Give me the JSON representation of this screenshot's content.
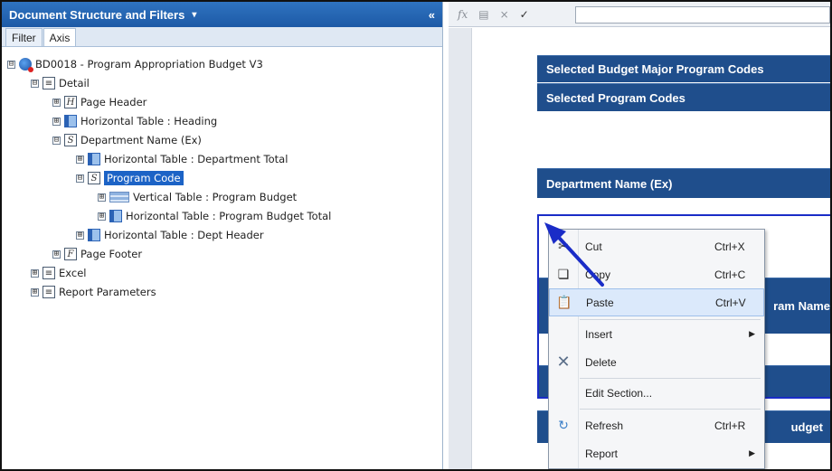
{
  "panel": {
    "title": "Document Structure and Filters",
    "dropdown_glyph": "▾",
    "collapse_glyph": "«",
    "tabs": [
      "Filter",
      "Axis"
    ]
  },
  "tree": {
    "items": [
      {
        "label": "BD0018 - Program Appropriation Budget V3",
        "icon": "report-icon",
        "expander": "⊟"
      },
      {
        "label": "Detail",
        "icon": "section-icon",
        "expander": "⊟"
      },
      {
        "label": "Page Header",
        "icon": "header-icon",
        "glyph": "H",
        "expander": "⊞"
      },
      {
        "label": "Horizontal Table : Heading",
        "icon": "horizontal-table-icon",
        "expander": "⊞"
      },
      {
        "label": "Department Name (Ex)",
        "icon": "section-s-icon",
        "glyph": "S",
        "expander": "⊟"
      },
      {
        "label": "Horizontal Table : Department Total",
        "icon": "horizontal-table-icon",
        "expander": "⊞"
      },
      {
        "label": "Program Code",
        "icon": "section-s-icon",
        "glyph": "S",
        "expander": "⊟"
      },
      {
        "label": "Vertical Table : Program Budget",
        "icon": "vertical-table-icon",
        "expander": "⊞"
      },
      {
        "label": "Horizontal Table : Program Budget Total",
        "icon": "horizontal-table-icon",
        "expander": "⊞"
      },
      {
        "label": "Horizontal Table : Dept Header",
        "icon": "horizontal-table-icon",
        "expander": "⊞"
      },
      {
        "label": "Page Footer",
        "icon": "footer-icon",
        "glyph": "F",
        "expander": "⊞"
      },
      {
        "label": "Excel",
        "icon": "section-icon",
        "expander": "⊞"
      },
      {
        "label": "Report Parameters",
        "icon": "section-icon",
        "expander": "⊞"
      }
    ]
  },
  "formula_bar": {
    "fx": "fx",
    "cancel": "×",
    "accept": "✓"
  },
  "report": {
    "band1": "Selected Budget Major Program Codes",
    "band2": "Selected Program Codes",
    "band3": "Department Name (Ex)",
    "band4_partial": "ram Name",
    "band5_partial": "udget"
  },
  "context_menu": {
    "items": [
      {
        "label": "Cut",
        "shortcut": "Ctrl+X",
        "icon": "cut-icon"
      },
      {
        "label": "Copy",
        "shortcut": "Ctrl+C",
        "icon": "copy-icon"
      },
      {
        "label": "Paste",
        "shortcut": "Ctrl+V",
        "icon": "paste-icon"
      },
      {
        "label": "Insert",
        "shortcut": "",
        "icon": "",
        "submenu": true
      },
      {
        "label": "Delete",
        "shortcut": "",
        "icon": "delete-icon"
      },
      {
        "label": "Edit Section...",
        "shortcut": "",
        "icon": ""
      },
      {
        "label": "Refresh",
        "shortcut": "Ctrl+R",
        "icon": "refresh-icon"
      },
      {
        "label": "Report",
        "shortcut": "",
        "icon": "",
        "submenu": true
      }
    ],
    "highlighted": "Paste"
  },
  "colors": {
    "header_blue": "#1d5aa6",
    "band_blue": "#1f4e8c",
    "selection_blue": "#1c63c6",
    "annotation_arrow": "#1a2cc7"
  }
}
